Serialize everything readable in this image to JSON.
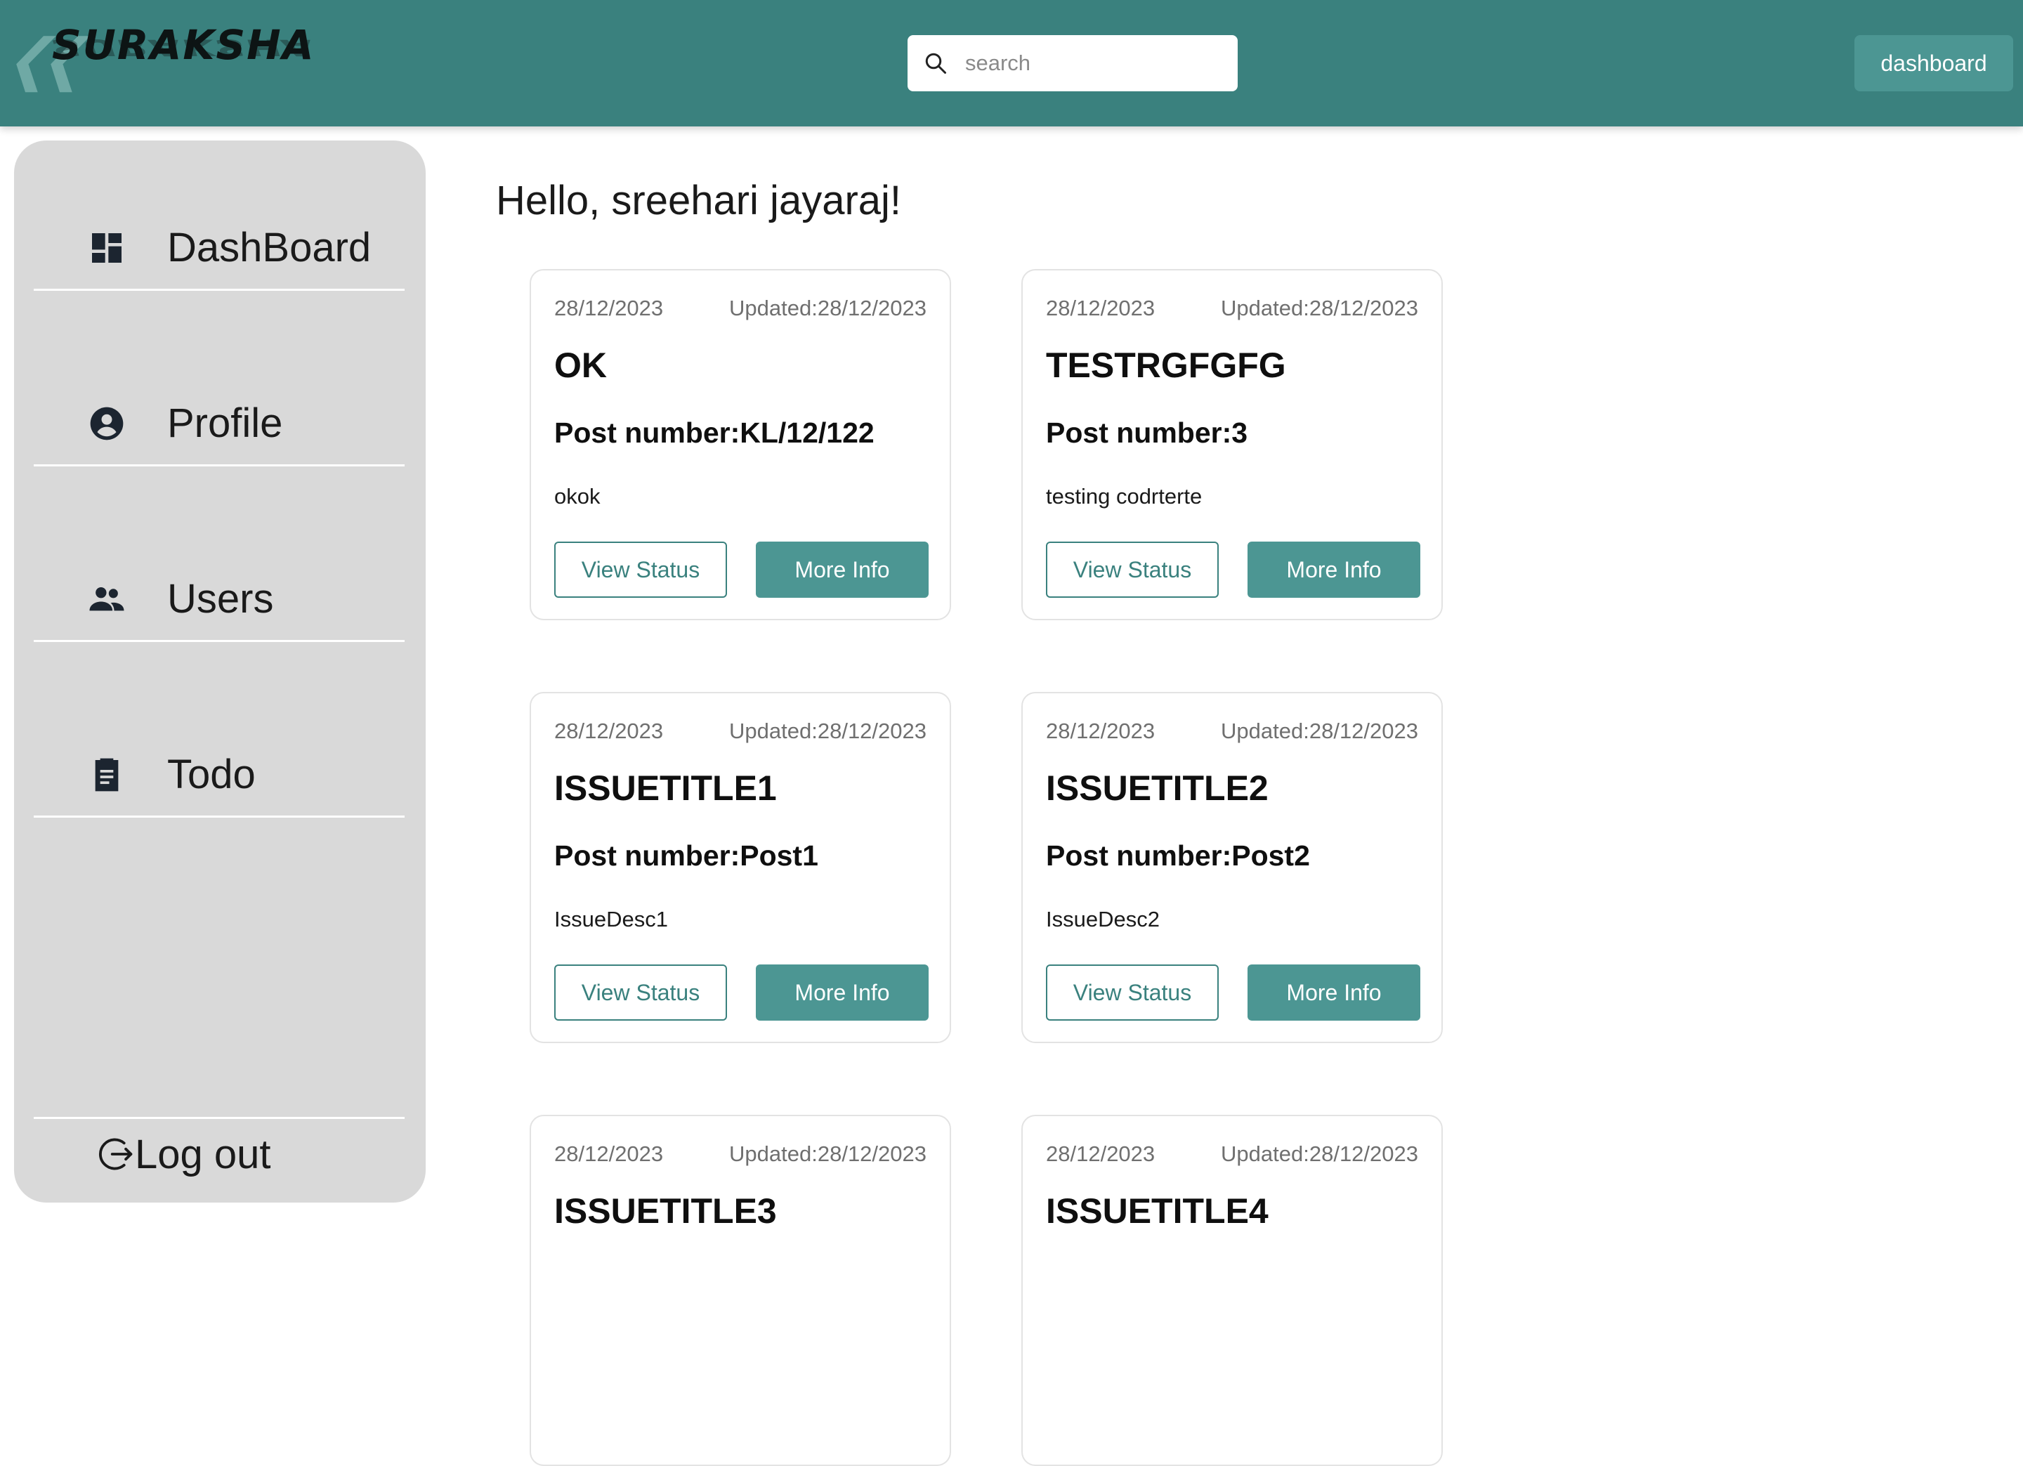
{
  "header": {
    "brand": "SURAKSHA",
    "search_placeholder": "search",
    "dashboard_button": "dashboard"
  },
  "sidebar": {
    "items": [
      {
        "label": "DashBoard",
        "icon": "dashboard-icon"
      },
      {
        "label": "Profile",
        "icon": "account-circle-icon"
      },
      {
        "label": "Users",
        "icon": "people-icon"
      },
      {
        "label": "Todo",
        "icon": "clipboard-icon"
      }
    ],
    "logout_label": "Log out"
  },
  "main": {
    "greeting": "Hello, sreehari jayaraj!",
    "cards": [
      {
        "date": "28/12/2023",
        "updated": "Updated:28/12/2023",
        "title": "OK",
        "post_number": "Post number:KL/12/122",
        "description": "okok",
        "view_status": "View Status",
        "more_info": "More Info"
      },
      {
        "date": "28/12/2023",
        "updated": "Updated:28/12/2023",
        "title": "TESTRGFGFG",
        "post_number": "Post number:3",
        "description": "testing codrterte",
        "view_status": "View Status",
        "more_info": "More Info"
      },
      {
        "date": "28/12/2023",
        "updated": "Updated:28/12/2023",
        "title": "ISSUETITLE1",
        "post_number": "Post number:Post1",
        "description": "IssueDesc1",
        "view_status": "View Status",
        "more_info": "More Info"
      },
      {
        "date": "28/12/2023",
        "updated": "Updated:28/12/2023",
        "title": "ISSUETITLE2",
        "post_number": "Post number:Post2",
        "description": "IssueDesc2",
        "view_status": "View Status",
        "more_info": "More Info"
      },
      {
        "date": "28/12/2023",
        "updated": "Updated:28/12/2023",
        "title": "ISSUETITLE3"
      },
      {
        "date": "28/12/2023",
        "updated": "Updated:28/12/2023",
        "title": "ISSUETITLE4"
      }
    ]
  },
  "colors": {
    "header": "#3a817e",
    "button": "#4c9693",
    "sidebar": "#d9d9d9"
  }
}
